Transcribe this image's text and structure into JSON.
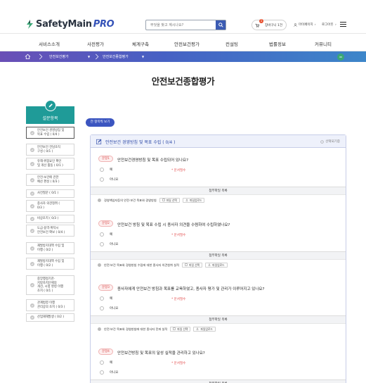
{
  "header": {
    "logo_main": "SafetyMain",
    "logo_pro": "PRO",
    "search_placeholder": "무엇을 찾고 계시나요?",
    "cart_label": "장바구니 1건",
    "cart_count": "1",
    "mypage_label": "마이페이지",
    "login_label": "로그아웃"
  },
  "nav": [
    "서비스소개",
    "사전평가",
    "체계구축",
    "안전보건평가",
    "컨설팅",
    "법률정보",
    "커뮤니티"
  ],
  "breadcrumb": {
    "level1": "안전보건평가",
    "level2": "안전보건종합평가"
  },
  "page_title": "안전보건종합평가",
  "sidebar": {
    "title": "설문항목",
    "items": [
      {
        "label": "안전보건 경영방침 및 목표 수립 ( 0/4 )",
        "lines": [
          "안전보건 경영방침 및",
          "목표 수립 ( 0/4 )"
        ],
        "active": true
      },
      {
        "label": "안전보건 전담조직 구성 ( 0/1 )",
        "lines": [
          "안전보건 전담조직",
          "구성 ( 0/1 )"
        ],
        "active": false
      },
      {
        "label": "유해·위험요인 확인 및 개선 활동 ( 0/1 )",
        "lines": [
          "유해·위험요인 확인",
          "및 개선 활동 ( 0/1 )"
        ],
        "active": false
      },
      {
        "label": "안전·보건에 관한 예산 편성 ( 0/3 )",
        "lines": [
          "안전·보건에 관한",
          "예산 편성 ( 0/3 )"
        ],
        "active": false
      },
      {
        "label": "사전질문 ( 0/1 )",
        "lines": [
          "사전질문 ( 0/1 )"
        ],
        "active": false
      },
      {
        "label": "종사자 의견청취 ( 0/3 )",
        "lines": [
          "종사자 의견청취 (",
          "0/3 )"
        ],
        "active": false
      },
      {
        "label": "비상조치 ( 0/3 )",
        "lines": [
          "비상조치 ( 0/3 )"
        ],
        "active": false
      },
      {
        "label": "도급·용역·위탁시 안전보건 확보 ( 0/4 )",
        "lines": [
          "도급·용역·위탁시",
          "안전보건 확보 ( 0/4 )"
        ],
        "active": false
      },
      {
        "label": "재발방지대책 수립 및 이행 ( 0/2 )",
        "lines": [
          "재발방지대책 수립 및",
          "이행 ( 0/2 )"
        ],
        "active": false
      },
      {
        "label": "재발방지대책 수립 및 이행 ( 0/2 )",
        "lines": [
          "재발방지대책 수립 및",
          "이행 ( 0/2 )"
        ],
        "active": false
      },
      {
        "label": "중앙행정기관·지방자치단체의 개선, 시정 명령 이행 조치 ( 0/1 )",
        "lines": [
          "중앙행정기관·",
          "지방자치단체의",
          "개선, 시정 명령 이행",
          "조치 ( 0/1 )"
        ],
        "active": false
      },
      {
        "label": "관계법령 이행 관리상의 조치 ( 0/3 )",
        "lines": [
          "관계법령 이행",
          "관리상의 조치 ( 0/3 )"
        ],
        "active": false
      },
      {
        "label": "산업재해발생 ( 0/2 )",
        "lines": [
          "산업재해발생 ( 0/2 )"
        ],
        "active": false
      }
    ]
  },
  "view_all_button": "전 항목씩 보기",
  "section": {
    "title": "안전보건 경영방침 및 목표 수립 ( 0/4 )",
    "right_label": "선택되기중",
    "questions": [
      {
        "tag": "문항1",
        "text": "안전보건경영방침 및 목표 수립되어 있나요?",
        "options": [
          "예",
          "아니요"
        ],
        "required": "* 문서필수",
        "attachment_header": "첨부파일 목록",
        "attachment_label": "경영책임자등의 안전·보건 목표와 경영방침",
        "file_button": "파일 선택",
        "upload_button": "파일업로드"
      },
      {
        "tag": "문항2",
        "text": "안전보건 방침 및 목표 수립 시 종사자 의견을 수렴하여 수립하였나요?",
        "options": [
          "예",
          "아니요"
        ],
        "required": "* 문서필수",
        "attachment_header": "첨부파일 목록",
        "attachment_label": "안전·보건 목표와 경영방침 수립에 대한 종사자 의견청취 실적",
        "file_button": "파일 선택",
        "upload_button": "파일업로드"
      },
      {
        "tag": "문항3",
        "text": "종사자에게 안전보건 방침과 목표를 교육하였고, 종사자 평가 및 관리가 이루어지고 있나요?",
        "options": [
          "예",
          "아니요"
        ],
        "required": "* 문서필수",
        "attachment_header": "첨부파일 목록",
        "attachment_label": "안전·보건 목표와 경영방침에 대한 종사자 전파 실적",
        "file_button": "파일 선택",
        "upload_button": "파일업로드"
      },
      {
        "tag": "문항4",
        "text": "안전보건방침 및 목표의 달성 실적을 관리하고 있나요?",
        "options": [
          "예",
          "아니요"
        ],
        "required": "* 문서필수",
        "attachment_header": "첨부파일 목록"
      }
    ]
  },
  "colors": {
    "primary": "#3b55c0",
    "teal": "#1f9b98",
    "required": "#e24b4b"
  }
}
